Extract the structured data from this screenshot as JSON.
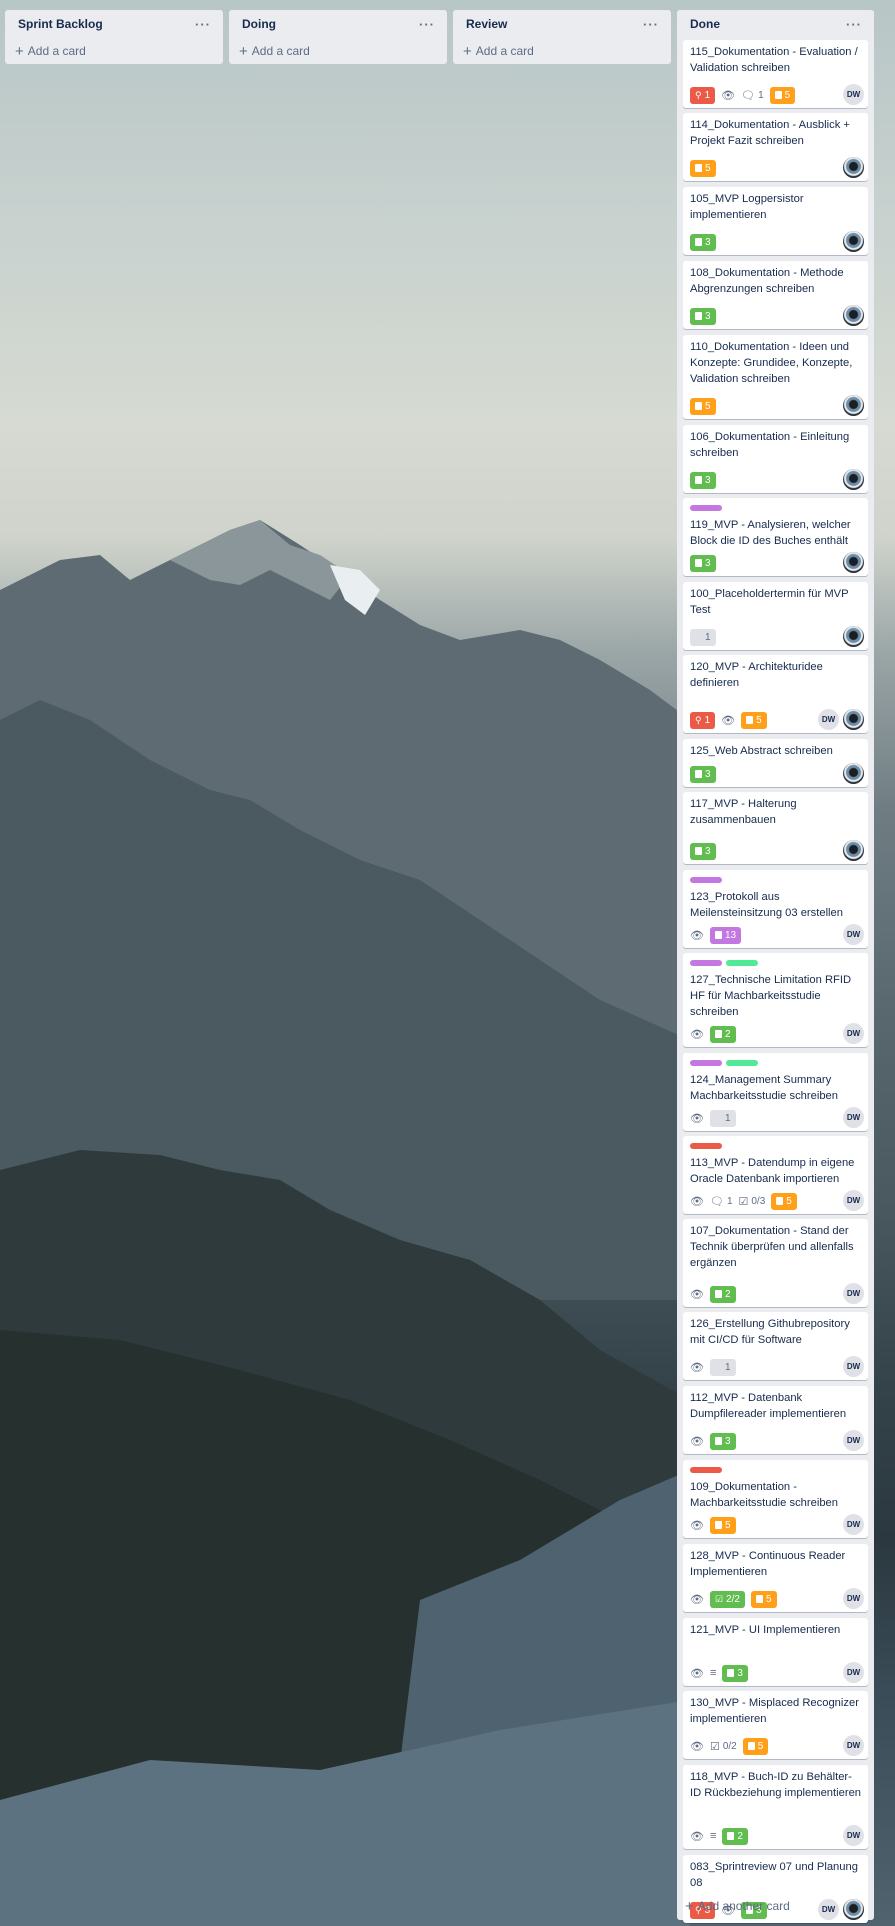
{
  "colors": {
    "green": "#61bd4f",
    "orange": "#ff9f1a",
    "red": "#eb5a46",
    "purple": "#c377e0",
    "lime": "#51e898",
    "grey": "#dfe1e6"
  },
  "lists": [
    {
      "title": "Sprint Backlog",
      "menu": "···",
      "add_card": "Add a card"
    },
    {
      "title": "Doing",
      "menu": "···",
      "add_card": "Add a card"
    },
    {
      "title": "Review",
      "menu": "···",
      "add_card": "Add a card"
    }
  ],
  "done": {
    "title": "Done",
    "menu": "···",
    "add_card": "Add another card",
    "cards": [
      {
        "title": "115_Dokumentation - Evaluation / Validation schreiben",
        "labels": [],
        "badges": [
          {
            "kind": "pill",
            "color": "red",
            "text": "1",
            "icon": "pin-icon"
          },
          {
            "kind": "icon",
            "icon": "watch-icon"
          },
          {
            "kind": "count",
            "icon": "comment-icon",
            "text": "1"
          },
          {
            "kind": "pill",
            "color": "orange",
            "text": "5"
          }
        ],
        "members": [
          "DW"
        ]
      },
      {
        "title": "114_Dokumentation - Ausblick + Projekt Fazit schreiben",
        "labels": [],
        "badges": [
          {
            "kind": "pill",
            "color": "orange",
            "text": "5"
          }
        ],
        "members": [
          "eye"
        ]
      },
      {
        "title": "105_MVP Logpersistor implementieren",
        "labels": [],
        "badges": [
          {
            "kind": "pill",
            "color": "green",
            "text": "3"
          }
        ],
        "members": [
          "eye"
        ]
      },
      {
        "title": "108_Dokumentation - Methode Abgrenzungen schreiben",
        "labels": [],
        "badges": [
          {
            "kind": "pill",
            "color": "green",
            "text": "3"
          }
        ],
        "members": [
          "eye"
        ]
      },
      {
        "title": "110_Dokumentation - Ideen und Konzepte: Grundidee, Konzepte, Validation schreiben",
        "labels": [],
        "badges": [
          {
            "kind": "pill",
            "color": "orange",
            "text": "5"
          }
        ],
        "members": [
          "eye"
        ]
      },
      {
        "title": "106_Dokumentation - Einleitung schreiben",
        "labels": [],
        "badges": [
          {
            "kind": "pill",
            "color": "green",
            "text": "3"
          }
        ],
        "members": [
          "eye"
        ]
      },
      {
        "title": "119_MVP - Analysieren, welcher Block die ID des Buches enthält",
        "labels": [
          "purple"
        ],
        "badges": [
          {
            "kind": "pill",
            "color": "green",
            "text": "3"
          }
        ],
        "members": [
          "eye"
        ]
      },
      {
        "title": "100_Placeholdertermin für MVP Test",
        "labels": [],
        "badges": [
          {
            "kind": "pill",
            "color": "grey",
            "text": "1"
          }
        ],
        "members": [
          "eye"
        ]
      },
      {
        "title": "120_MVP - Architekturidee definieren",
        "labels": [],
        "badges": [
          {
            "kind": "pill",
            "color": "red",
            "text": "1",
            "icon": "pin-icon"
          },
          {
            "kind": "icon",
            "icon": "watch-icon"
          },
          {
            "kind": "pill",
            "color": "orange",
            "text": "5"
          }
        ],
        "members": [
          "DW",
          "eye"
        ]
      },
      {
        "title": "125_Web Abstract schreiben",
        "labels": [],
        "badges": [
          {
            "kind": "pill",
            "color": "green",
            "text": "3"
          }
        ],
        "members": [
          "eye"
        ]
      },
      {
        "title": "117_MVP - Halterung zusammenbauen",
        "labels": [],
        "badges": [
          {
            "kind": "pill",
            "color": "green",
            "text": "3"
          }
        ],
        "members": [
          "eye"
        ]
      },
      {
        "title": "123_Protokoll aus Meilensteinsitzung 03 erstellen",
        "labels": [
          "purple"
        ],
        "badges": [
          {
            "kind": "icon",
            "icon": "watch-icon"
          },
          {
            "kind": "pill",
            "color": "purple",
            "text": "13"
          }
        ],
        "members": [
          "DW"
        ]
      },
      {
        "title": "127_Technische Limitation RFID HF für Machbarkeitsstudie schreiben",
        "labels": [
          "purple",
          "lime"
        ],
        "badges": [
          {
            "kind": "icon",
            "icon": "watch-icon"
          },
          {
            "kind": "pill",
            "color": "green",
            "text": "2"
          }
        ],
        "members": [
          "DW"
        ]
      },
      {
        "title": "124_Management Summary Machbarkeitsstudie schreiben",
        "labels": [
          "purple",
          "lime"
        ],
        "badges": [
          {
            "kind": "icon",
            "icon": "watch-icon"
          },
          {
            "kind": "pill",
            "color": "grey",
            "text": "1"
          }
        ],
        "members": [
          "DW"
        ]
      },
      {
        "title": "113_MVP - Datendump in eigene Oracle Datenbank importieren",
        "labels": [
          "red"
        ],
        "badges": [
          {
            "kind": "icon",
            "icon": "watch-icon"
          },
          {
            "kind": "count",
            "icon": "comment-icon",
            "text": "1"
          },
          {
            "kind": "count",
            "icon": "checklist-icon",
            "text": "0/3"
          },
          {
            "kind": "pill",
            "color": "orange",
            "text": "5"
          }
        ],
        "members": [
          "DW"
        ]
      },
      {
        "title": "107_Dokumentation - Stand der Technik überprüfen und allenfalls ergänzen",
        "labels": [],
        "badges": [
          {
            "kind": "icon",
            "icon": "watch-icon"
          },
          {
            "kind": "pill",
            "color": "green",
            "text": "2"
          }
        ],
        "members": [
          "DW"
        ]
      },
      {
        "title": "126_Erstellung Githubrepository mit CI/CD für Software",
        "labels": [],
        "badges": [
          {
            "kind": "icon",
            "icon": "watch-icon"
          },
          {
            "kind": "pill",
            "color": "grey",
            "text": "1"
          }
        ],
        "members": [
          "DW"
        ]
      },
      {
        "title": "112_MVP - Datenbank Dumpfilereader implementieren",
        "labels": [],
        "badges": [
          {
            "kind": "icon",
            "icon": "watch-icon"
          },
          {
            "kind": "pill",
            "color": "green",
            "text": "3"
          }
        ],
        "members": [
          "DW"
        ]
      },
      {
        "title": "109_Dokumentation - Machbarkeitsstudie schreiben",
        "labels": [
          "red"
        ],
        "badges": [
          {
            "kind": "icon",
            "icon": "watch-icon"
          },
          {
            "kind": "pill",
            "color": "orange",
            "text": "5"
          }
        ],
        "members": [
          "DW"
        ]
      },
      {
        "title": "128_MVP - Continuous Reader Implementieren",
        "labels": [],
        "badges": [
          {
            "kind": "icon",
            "icon": "watch-icon"
          },
          {
            "kind": "pill",
            "color": "green",
            "text": "2/2",
            "icon": "checklist-icon"
          },
          {
            "kind": "pill",
            "color": "orange",
            "text": "5"
          }
        ],
        "members": [
          "DW"
        ]
      },
      {
        "title": "121_MVP - UI Implementieren",
        "labels": [],
        "badges": [
          {
            "kind": "icon",
            "icon": "watch-icon"
          },
          {
            "kind": "icon",
            "icon": "description-icon"
          },
          {
            "kind": "pill",
            "color": "green",
            "text": "3"
          }
        ],
        "members": [
          "DW"
        ]
      },
      {
        "title": "130_MVP - Misplaced Recognizer implementieren",
        "labels": [],
        "badges": [
          {
            "kind": "icon",
            "icon": "watch-icon"
          },
          {
            "kind": "count",
            "icon": "checklist-icon",
            "text": "0/2"
          },
          {
            "kind": "pill",
            "color": "orange",
            "text": "5"
          }
        ],
        "members": [
          "DW"
        ]
      },
      {
        "title": "118_MVP - Buch-ID zu Behälter-ID Rückbeziehung implementieren",
        "labels": [],
        "badges": [
          {
            "kind": "icon",
            "icon": "watch-icon"
          },
          {
            "kind": "icon",
            "icon": "description-icon"
          },
          {
            "kind": "pill",
            "color": "green",
            "text": "2"
          }
        ],
        "members": [
          "DW"
        ]
      },
      {
        "title": "083_Sprintreview 07 und Planung 08",
        "labels": [],
        "badges": [
          {
            "kind": "pill",
            "color": "red",
            "text": "3",
            "icon": "pin-icon"
          },
          {
            "kind": "icon",
            "icon": "watch-icon"
          },
          {
            "kind": "pill",
            "color": "green",
            "text": "3"
          }
        ],
        "members": [
          "DW",
          "eye"
        ]
      }
    ]
  }
}
